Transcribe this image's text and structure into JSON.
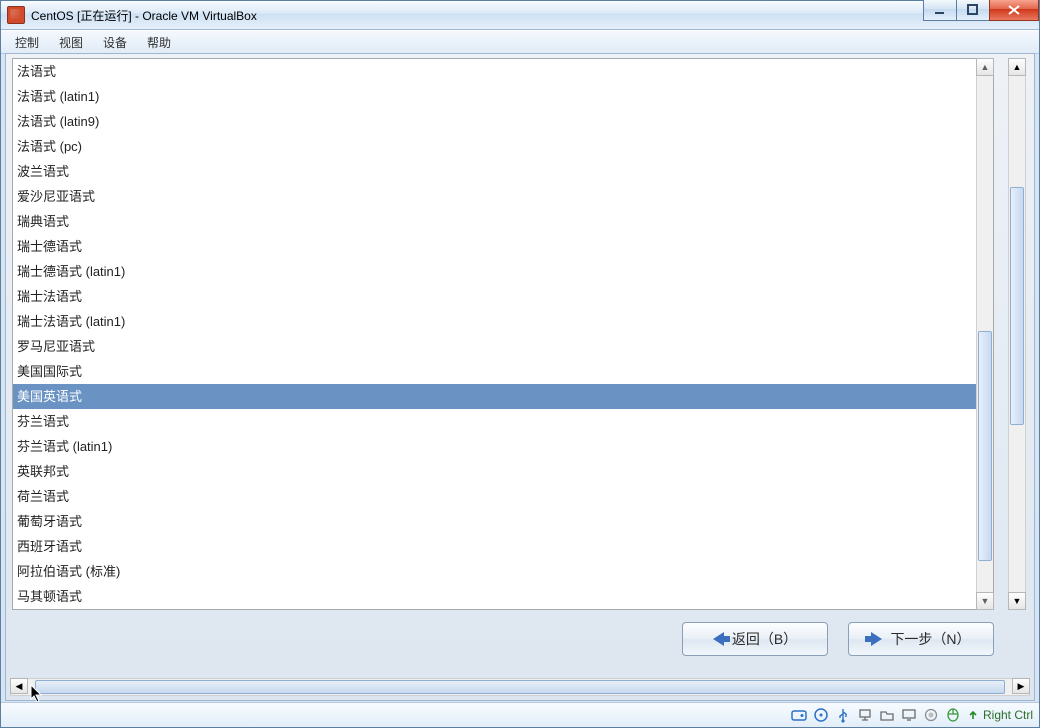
{
  "window": {
    "title": "CentOS [正在运行] - Oracle VM VirtualBox"
  },
  "menu": {
    "control": "控制",
    "view": "视图",
    "devices": "设备",
    "help": "帮助"
  },
  "keyboard_list": {
    "selected_index": 13,
    "items": [
      "法语式",
      "法语式 (latin1)",
      "法语式 (latin9)",
      "法语式 (pc)",
      "波兰语式",
      "爱沙尼亚语式",
      "瑞典语式",
      "瑞士德语式",
      "瑞士德语式 (latin1)",
      "瑞士法语式",
      "瑞士法语式 (latin1)",
      "罗马尼亚语式",
      "美国国际式",
      "美国英语式",
      "芬兰语式",
      "芬兰语式 (latin1)",
      "英联邦式",
      "荷兰语式",
      "葡萄牙语式",
      "西班牙语式",
      "阿拉伯语式 (标准)",
      "马其顿语式"
    ]
  },
  "buttons": {
    "back": "返回（B）",
    "next": "下一步（N）"
  },
  "status": {
    "host_key": "Right Ctrl"
  },
  "icons": {
    "minimize": "minimize-icon",
    "maximize": "maximize-icon",
    "close": "close-icon",
    "disk": "disk-icon",
    "optical": "optical-icon",
    "usb": "usb-icon",
    "network": "network-icon",
    "shared": "shared-folder-icon",
    "display": "display-icon",
    "mouse": "mouse-capture-icon",
    "record": "record-icon",
    "hostkey": "hostkey-icon"
  }
}
